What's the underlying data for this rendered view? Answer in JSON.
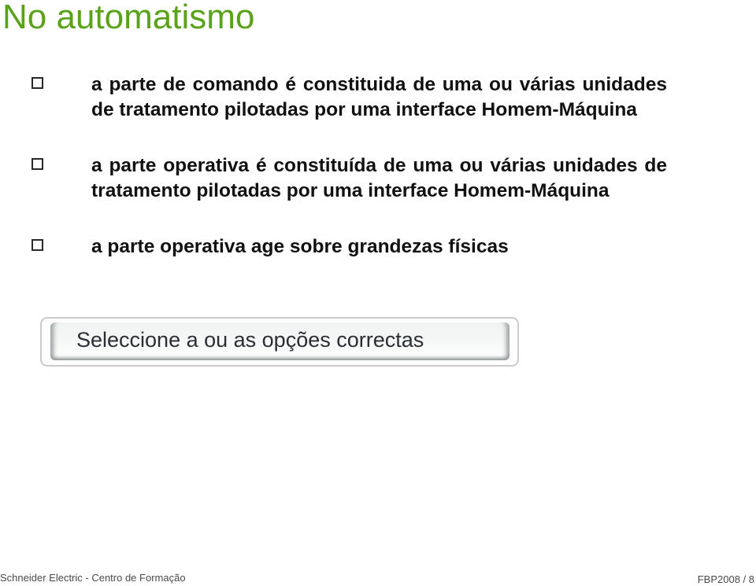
{
  "slide": {
    "title": "No automatismo",
    "title_color": "#5aa21a"
  },
  "options": [
    {
      "text": "a parte de comando é constituida de uma ou várias unidades de tratamento pilotadas por uma interface Homem-Máquina",
      "checked": false
    },
    {
      "text": "a parte operativa é constituída de uma ou várias unidades de tratamento pilotadas por uma interface Homem-Máquina",
      "checked": false
    },
    {
      "text": "a parte operativa age sobre grandezas físicas",
      "checked": false
    }
  ],
  "instruction_button": {
    "label": "Seleccione a ou as opções correctas"
  },
  "footer": {
    "left": "Schneider Electric - Centro de Formação",
    "right": "FBP2008 / 8"
  }
}
